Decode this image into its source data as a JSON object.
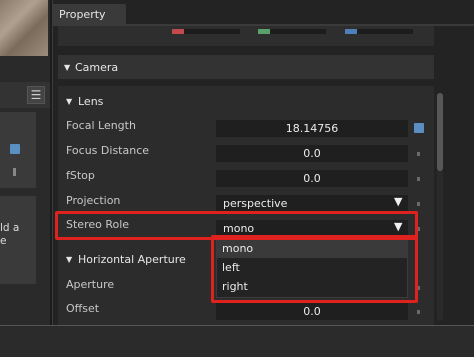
{
  "left_panel": {
    "partial_text": "ld a\ne"
  },
  "tab": {
    "label": "Property"
  },
  "colors": {
    "accent": "#5b8fc2",
    "highlight": "#e0221f",
    "swatch_red": "#c24a4a",
    "swatch_green": "#5aa06b",
    "swatch_blue": "#4f7fb8"
  },
  "camera": {
    "title": "Camera"
  },
  "lens": {
    "title": "Lens",
    "focal_length": {
      "label": "Focal Length",
      "value": "18.14756"
    },
    "focus_distance": {
      "label": "Focus Distance",
      "value": "0.0"
    },
    "fstop": {
      "label": "fStop",
      "value": "0.0"
    },
    "projection": {
      "label": "Projection",
      "value": "perspective"
    },
    "stereo_role": {
      "label": "Stereo Role",
      "value": "mono",
      "options": [
        "mono",
        "left",
        "right"
      ]
    }
  },
  "horizontal_aperture": {
    "title": "Horizontal Aperture",
    "aperture": {
      "label": "Aperture"
    },
    "offset": {
      "label": "Offset",
      "value": "0.0"
    }
  }
}
